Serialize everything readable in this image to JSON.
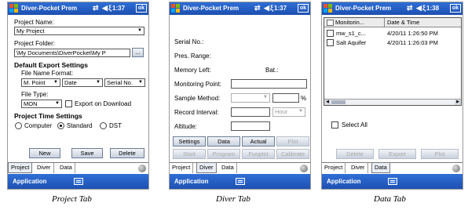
{
  "statusbar": {
    "app_title": "Diver-Pocket Prem",
    "signal_icons": "⇄ ◀ξ",
    "ok_label": "ok",
    "time_project": "1:37",
    "time_diver": "1:37",
    "time_data": "1:38"
  },
  "project_tab": {
    "project_name_label": "Project Name:",
    "project_name_value": "My Project",
    "project_folder_label": "Project Folder:",
    "project_folder_value": "\\My Documents\\DiverPocket\\My P",
    "browse_label": "...",
    "default_export_heading": "Default Export Settings",
    "file_name_format_label": "File Name Format:",
    "format_1": "M. Point",
    "format_2": "Date",
    "format_3": "Serial No.",
    "file_type_label": "File Type:",
    "file_type_value": "MON",
    "export_on_download_label": "Export on Download",
    "time_settings_heading": "Project Time Settings",
    "radio_computer": "Computer",
    "radio_standard": "Standard",
    "radio_dst": "DST",
    "new_label": "New",
    "save_label": "Save",
    "delete_label": "Delete"
  },
  "diver_tab": {
    "serial_label": "Serial No.:",
    "pres_range_label": "Pres. Range:",
    "memory_left_label": "Memory Left:",
    "bat_label": "Bat.:",
    "monitoring_point_label": "Monitoring Point:",
    "sample_method_label": "Sample Method:",
    "percent_label": "%",
    "record_interval_label": "Record Interval:",
    "interval_unit": "Hour",
    "altitude_label": "Altitude:",
    "buttons_row1": [
      "Settings",
      "Data",
      "Actual",
      "Plot"
    ],
    "buttons_row2": [
      "Start",
      "Program",
      "Funptst",
      "Calibrate"
    ]
  },
  "data_tab": {
    "col_monitoring": "Monitorin...",
    "col_datetime": "Date & Time",
    "rows": [
      {
        "name": "mw_s1_c...",
        "datetime": "4/20/11 1:26:50 PM"
      },
      {
        "name": "Salt Aquifer",
        "datetime": "4/20/11 1:26:03 PM"
      }
    ],
    "select_all_label": "Select All",
    "buttons": [
      "Delete",
      "Export",
      "Plot"
    ]
  },
  "tabs": {
    "project": "Project",
    "diver": "Diver",
    "data": "Data"
  },
  "appbar": {
    "label": "Application"
  },
  "captions": {
    "project": "Project Tab",
    "diver": "Diver Tab",
    "data": "Data Tab"
  },
  "colors": {
    "titlebar": "#2f6fd6",
    "appbar": "#1d4fb0"
  }
}
